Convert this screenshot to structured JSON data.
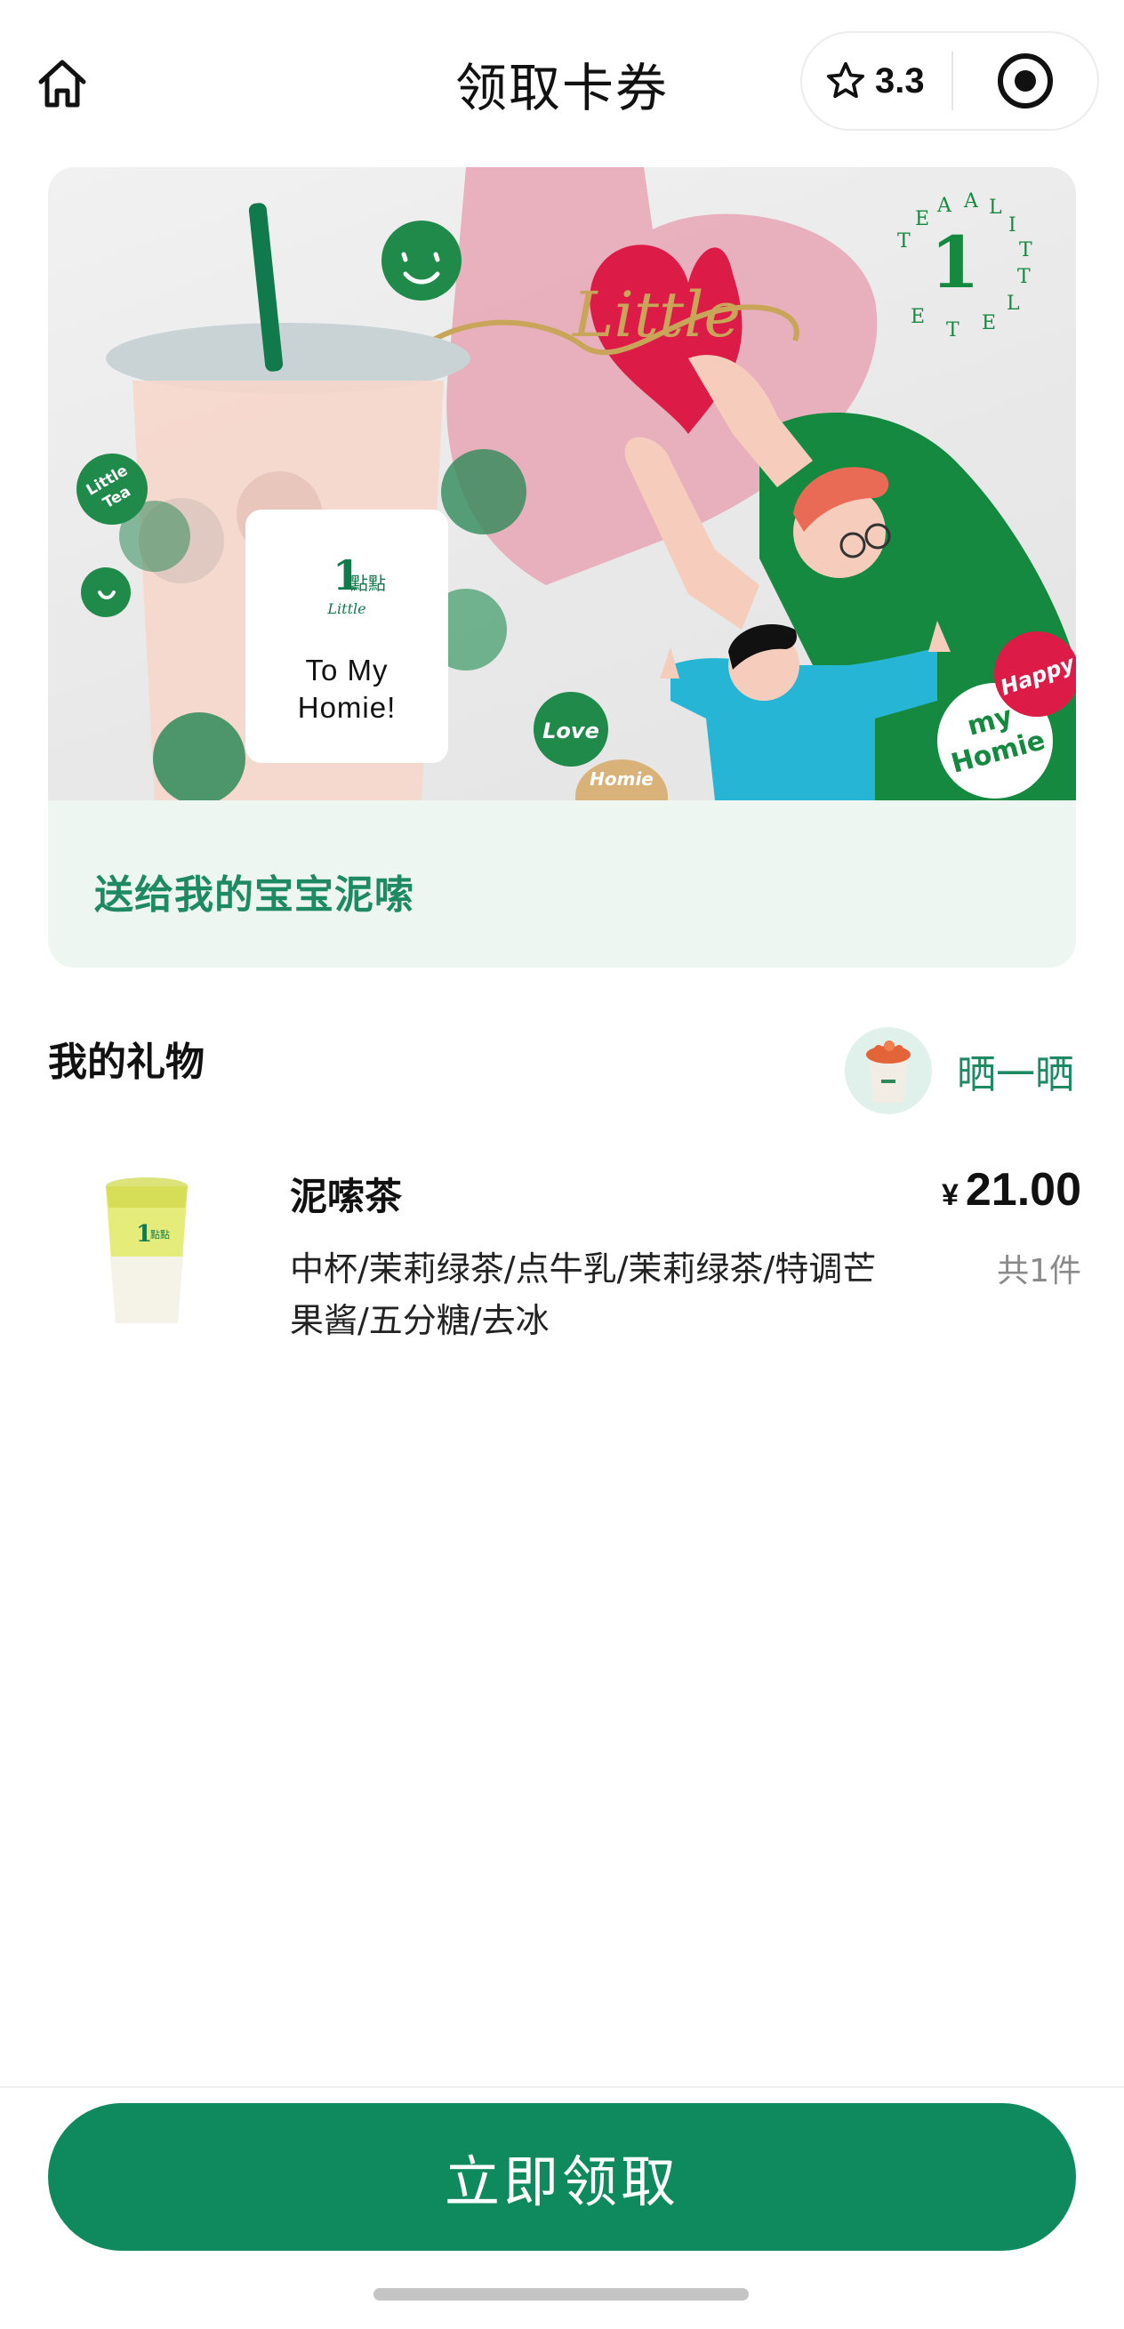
{
  "header": {
    "title": "领取卡券",
    "rating": "3.3",
    "home_icon": "home-icon",
    "star_icon": "star-icon",
    "target_icon": "target-icon"
  },
  "card": {
    "badge_text_line1": "To My",
    "badge_text_line2": "Homie!",
    "message": "送给我的宝宝泥嗦"
  },
  "gift": {
    "section_title": "我的礼物",
    "share_label": "晒一晒",
    "product": {
      "name": "泥嗦茶",
      "spec": "中杯/茉莉绿茶/点牛乳/茉莉绿茶/特调芒果酱/五分糖/去冰",
      "currency": "¥",
      "price": "21.00",
      "quantity": "共1件"
    }
  },
  "footer": {
    "claim_label": "立即领取"
  },
  "colors": {
    "brand_green": "#0f8a5f",
    "accent_green_text": "#1d8a63",
    "card_message_bg": "#eef6f1"
  }
}
